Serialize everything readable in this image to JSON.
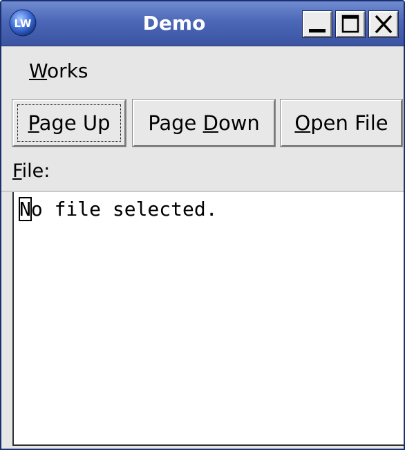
{
  "window": {
    "title": "Demo",
    "icon": "lw-app-icon"
  },
  "menubar": {
    "items": [
      {
        "label_underlined": "W",
        "label_rest": "orks"
      }
    ]
  },
  "toolbar": {
    "page_up": {
      "pre": "",
      "ul": "P",
      "post": "age Up"
    },
    "page_down": {
      "pre": "Page ",
      "ul": "D",
      "post": "own"
    },
    "open_file": {
      "pre": "",
      "ul": "O",
      "post": "pen File"
    }
  },
  "file_label": {
    "ul": "F",
    "post": "ile:"
  },
  "text_area": {
    "cursor_char": "N",
    "content_rest": "o file selected."
  },
  "colors": {
    "titlebar_top": "#6f8bd0",
    "titlebar_bottom": "#3a54a2",
    "window_bg": "#e6e6e6",
    "text_area_bg": "#ffffff"
  }
}
